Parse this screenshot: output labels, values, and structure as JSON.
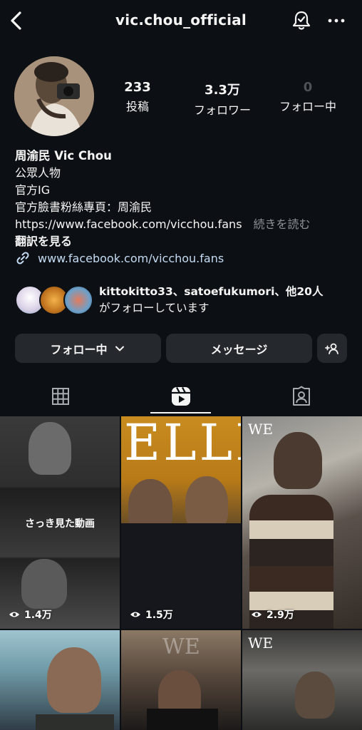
{
  "header": {
    "username": "vic.chou_official"
  },
  "stats": {
    "posts": {
      "value": "233",
      "label": "投稿"
    },
    "followers": {
      "value": "3.3万",
      "label": "フォロワー"
    },
    "following": {
      "value": "0",
      "label": "フォロー中"
    }
  },
  "bio": {
    "name": "周渝民 Vic Chou",
    "category": "公眾人物",
    "line1": "官方IG",
    "line2": "官方臉書粉絲專頁：周渝民",
    "line3": "https://www.facebook.com/vicchou.fans",
    "more": "続きを読む",
    "translate": "翻訳を見る",
    "link": "www.facebook.com/vicchou.fans"
  },
  "followed_by": {
    "names": "kittokitto33、satoefukumori、他20人",
    "suffix": "がフォローしています"
  },
  "buttons": {
    "following": "フォロー中",
    "message": "メッセージ"
  },
  "grid": {
    "items": [
      {
        "views": "1.4万",
        "overlay": "さっき見た動画"
      },
      {
        "views": "1.5万",
        "brand": "ELLE"
      },
      {
        "views": "2.9万",
        "brand": "WE"
      },
      {
        "views": ""
      },
      {
        "views": "",
        "brand": "WE"
      },
      {
        "views": "",
        "brand": "WE"
      }
    ]
  },
  "colors": {
    "background": "#0c1014",
    "button": "#25292e",
    "link": "#c5dbf3"
  }
}
